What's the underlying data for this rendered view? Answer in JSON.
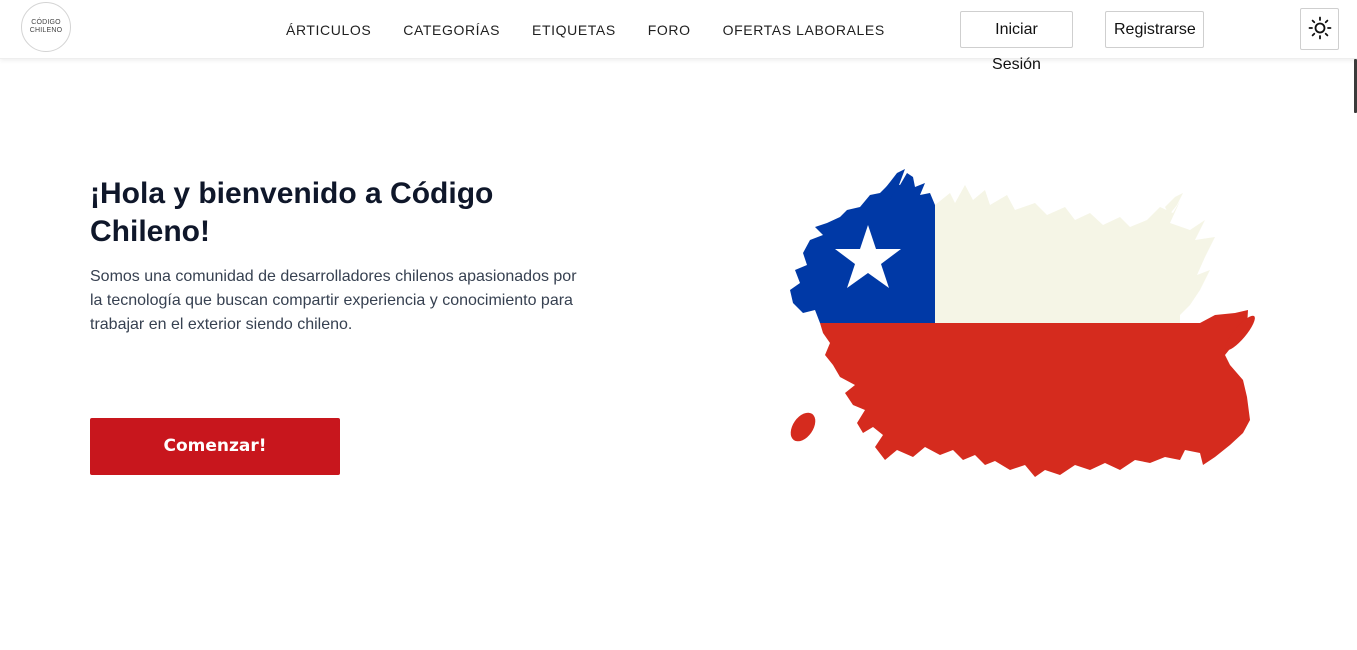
{
  "header": {
    "logo": {
      "line1": "CÓDIGO",
      "line2": "CHILENO"
    },
    "nav": [
      {
        "label": "ÁRTICULOS"
      },
      {
        "label": "CATEGORÍAS"
      },
      {
        "label": "ETIQUETAS"
      },
      {
        "label": "FORO"
      },
      {
        "label": "OFERTAS LABORALES"
      }
    ],
    "login_label": "Iniciar Sesión",
    "register_label": "Registrarse",
    "theme_icon": "sun-icon"
  },
  "hero": {
    "title": "¡Hola y bienvenido a Código Chileno!",
    "description": "Somos una comunidad de desarrolladores chilenos apasionados por la tecnología que buscan compartir experiencia y conocimiento para trabajar en el exterior siendo chileno.",
    "cta_label": "Comenzar!",
    "image": "chilean-flag-brush"
  },
  "colors": {
    "primary": "#c8161d",
    "flag_blue": "#0039a6",
    "flag_white": "#f5f5e6",
    "flag_red": "#d52b1e"
  }
}
